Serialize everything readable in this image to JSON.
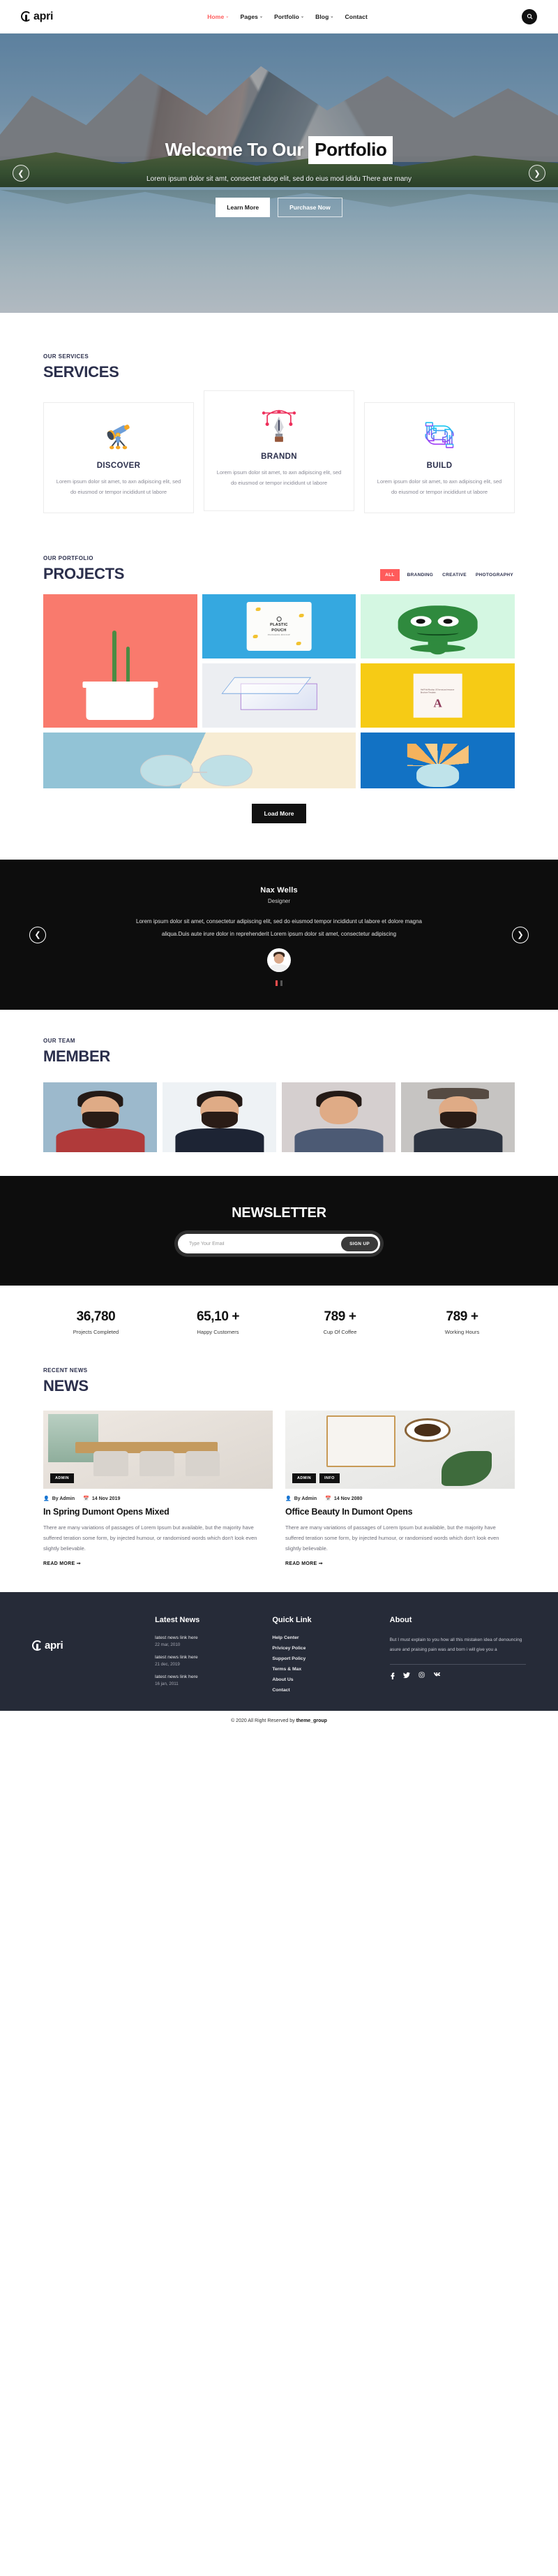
{
  "header": {
    "logo_text": "apri",
    "nav": [
      {
        "label": "Home",
        "caret": "⌄",
        "active": true
      },
      {
        "label": "Pages",
        "caret": "⌄",
        "active": false
      },
      {
        "label": "Portfolio",
        "caret": "⌄",
        "active": false
      },
      {
        "label": "Blog",
        "caret": "⌄",
        "active": false
      },
      {
        "label": "Contact",
        "caret": "",
        "active": false
      }
    ],
    "search_icon": "⌕"
  },
  "hero": {
    "title_1": "Welcome To Our",
    "title_2": "Portfolio",
    "subtitle": "Lorem ipsum dolor sit amt, consectet adop elit, sed do eius mod ididu There are many",
    "btn_primary": "Learn More",
    "btn_secondary": "Purchase Now",
    "arrow_left": "❮",
    "arrow_right": "❯"
  },
  "services": {
    "eyebrow": "OUR SERVICES",
    "title": "SERVICES",
    "cards": [
      {
        "name": "DISCOVER",
        "desc": "Lorem ipsum dolor sit amet, to axn adipiscing elit, sed do eiusmod or tempor incididunt ut labore",
        "icon": "telescope-icon"
      },
      {
        "name": "BRANDN",
        "desc": "Lorem ipsum dolor sit amet, to axn adipiscing elit, sed do eiusmod or tempor incididunt ut labore",
        "icon": "pen-nib-icon"
      },
      {
        "name": "BUILD",
        "desc": "Lorem ipsum dolor sit amet, to axn adipiscing elit, sed do eiusmod or tempor incididunt ut labore",
        "icon": "hands-puzzle-icon"
      }
    ]
  },
  "projects": {
    "eyebrow": "OUR PORTFOLIO",
    "title": "PROJECTS",
    "filters": [
      {
        "label": "ALL",
        "active": true
      },
      {
        "label": "BRANDING",
        "active": false
      },
      {
        "label": "CREATIVE",
        "active": false
      },
      {
        "label": "PHOTOGRAPHY",
        "active": false
      }
    ],
    "items": [
      {
        "name": "cactus-pot",
        "color": "#f97a6d"
      },
      {
        "name": "plastic-pouch",
        "color": "#35a8e0",
        "label_1": "PLASTIC",
        "label_2": "POUCH",
        "label_3": "PACKAGING MOCKUP"
      },
      {
        "name": "green-monster",
        "color": "#d4f7e2"
      },
      {
        "name": "glass-cube",
        "color": "#eceef2"
      },
      {
        "name": "letter-a-brochure",
        "color": "#f6cb15",
        "caption": "Half Fold Mockup US format psd resource Brochure Template."
      },
      {
        "name": "round-sunglasses",
        "color": "#92c3d6"
      },
      {
        "name": "blue-pineapple",
        "color": "#1272c4"
      }
    ],
    "load_more": "Load More"
  },
  "testimonial": {
    "name": "Nax Wells",
    "role": "Designer",
    "text": "Lorem ipsum dolor sit amet, consectetur adipiscing elit, sed do eiusmod tempor incididunt ut labore et dolore magna aliqua.Duis aute irure dolor in reprehenderit Lorem ipsum dolor sit amet, consectetur adipiscing",
    "arrow_left": "❮",
    "arrow_right": "❯"
  },
  "team": {
    "eyebrow": "OUR TEAM",
    "title": "MEMBER",
    "members": [
      {
        "name": "team-member-1"
      },
      {
        "name": "team-member-2"
      },
      {
        "name": "team-member-3"
      },
      {
        "name": "team-member-4"
      }
    ]
  },
  "newsletter": {
    "title": "NEWSLETTER",
    "placeholder": "Type Your Email",
    "value": "",
    "submit": "SIGN UP"
  },
  "counters": [
    {
      "number": "36,780",
      "label": "Projects Completed"
    },
    {
      "number": "65,10 +",
      "label": "Happy Customers"
    },
    {
      "number": "789 +",
      "label": "Cup Of Coffee"
    },
    {
      "number": "789 +",
      "label": "Working Hours"
    }
  ],
  "news": {
    "eyebrow": "RECENT NEWS",
    "title": "NEWS",
    "cards": [
      {
        "badges": [
          "ADMIN"
        ],
        "author": "By Admin",
        "date": "14 Nov 2019",
        "title": "In Spring Dumont Opens Mixed",
        "body": "There are many variations of passages of Lorem Ipsum but available, but the majority have suffered teration some form, by injected humour, or randomised words which don't look even slightly believable.",
        "read_more": "READ MORE ➞"
      },
      {
        "badges": [
          "ADMIN",
          "INFO"
        ],
        "author": "By Admin",
        "date": "14 Nov 2080",
        "title": "Office Beauty In Dumont Opens",
        "body": "There are many variations of passages of Lorem Ipsum but available, but the majority have suffered teration some form, by injected humour, or randomised words which don't look even slightly believable.",
        "read_more": "READ MORE ➞"
      }
    ]
  },
  "footer": {
    "logo_text": "apri",
    "latest_news": {
      "heading": "Latest News",
      "items": [
        {
          "title": "latest news link here",
          "date": "22 mar, 2010"
        },
        {
          "title": "latest news link here",
          "date": "21 dec, 2019"
        },
        {
          "title": "latest news link here",
          "date": "16 jan, 2011"
        }
      ]
    },
    "quick_link": {
      "heading": "Quick Link",
      "items": [
        "Help Center",
        "Privicey Police",
        "Support Policy",
        "Terms & Max",
        "About Us",
        "Contact"
      ]
    },
    "about": {
      "heading": "About",
      "text": "But I must explain to you how all this mistaken idea of denouncing asure and praising pain was and born i will give you a",
      "socials": [
        "facebook-icon",
        "twitter-icon",
        "instagram-icon",
        "vk-icon"
      ]
    }
  },
  "copyright": {
    "prefix": "© 2020 All Right Reserved by ",
    "brand": "theme_group"
  }
}
